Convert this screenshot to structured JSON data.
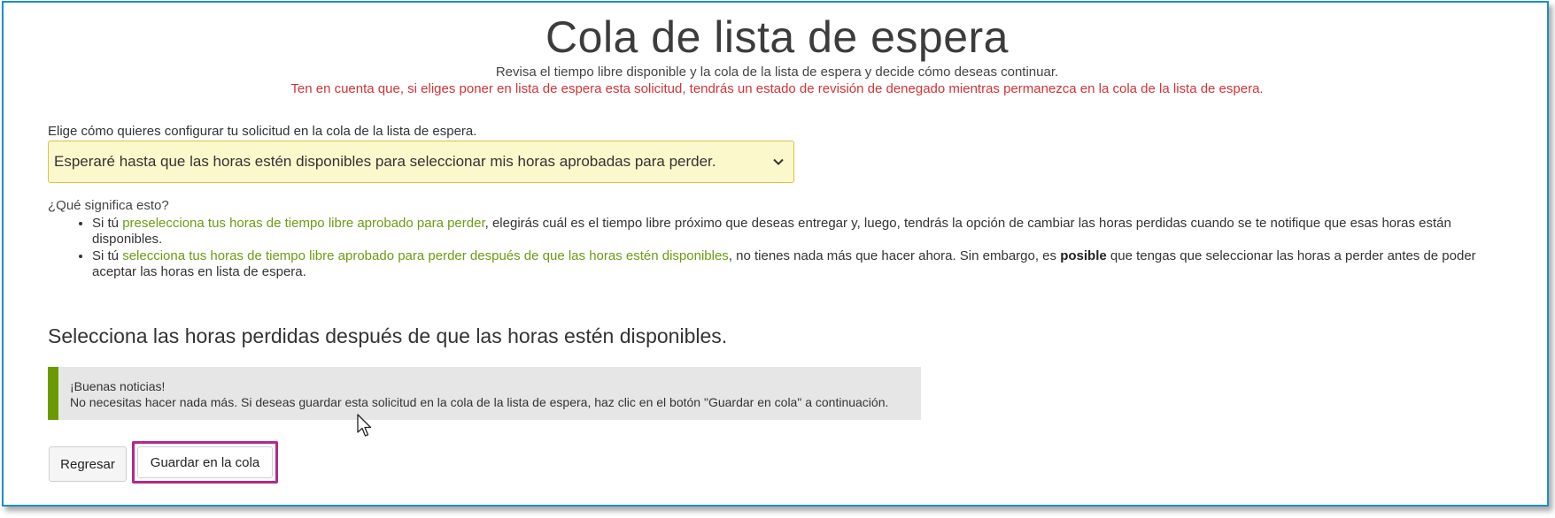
{
  "page": {
    "title": "Cola de lista de espera",
    "subtitle": "Revisa el tiempo libre disponible y la cola de la lista de espera y decide cómo deseas continuar.",
    "warning": "Ten en cuenta que, si eliges poner en lista de espera esta solicitud, tendrás un estado de revisión de denegado mientras permanezca en la cola de la lista de espera."
  },
  "config": {
    "label": "Elige cómo quieres configurar tu solicitud en la cola de la lista de espera.",
    "selected_option": "Esperaré hasta que las horas estén disponibles para seleccionar mis horas aprobadas para perder.",
    "icon": "chevron-down-icon"
  },
  "explanation": {
    "question": "¿Qué significa esto?",
    "items": [
      {
        "prefix": "Si tú ",
        "highlight": "preselecciona tus horas de tiempo libre aprobado para perder",
        "rest": ", elegirás cuál es el tiempo libre próximo que deseas entregar y, luego, tendrás la opción de cambiar las horas perdidas cuando se te notifique que esas horas están disponibles."
      },
      {
        "prefix": "Si tú ",
        "highlight": "selecciona tus horas de tiempo libre aprobado para perder después de que las horas estén disponibles",
        "rest_before_bold": ", no tienes nada más que hacer ahora. Sin embargo, es ",
        "bold": "posible",
        "rest_after_bold": " que tengas que seleccionar las horas a perder antes de poder aceptar las horas en lista de espera."
      }
    ]
  },
  "section": {
    "title": "Selecciona las horas perdidas después de que las horas estén disponibles."
  },
  "notice": {
    "heading": "¡Buenas noticias!",
    "body": "No necesitas hacer nada más. Si deseas guardar esta solicitud en la cola de la lista de espera, haz clic en el botón \"Guardar en cola\" a continuación.",
    "accent_color": "#6a9a00"
  },
  "buttons": {
    "back_label": "Regresar",
    "save_label": "Guardar en la cola"
  },
  "colors": {
    "frame": "#1e8fc4",
    "warning": "#d13438",
    "link_green": "#6e9b12",
    "select_bg": "#fbf9cc",
    "highlight_box": "#b5278c"
  }
}
